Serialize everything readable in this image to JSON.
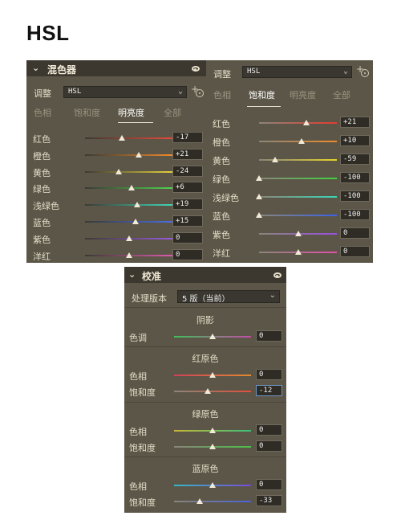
{
  "page_title": "HSL",
  "mixer": {
    "title": "混色器",
    "adjust_label": "调整",
    "adjust_value": "HSL",
    "tabs": [
      "色相",
      "饱和度",
      "明亮度",
      "全部"
    ],
    "active_tab": "明亮度",
    "rows": [
      {
        "label": "红色",
        "value": "-17",
        "level": -0.17
      },
      {
        "label": "橙色",
        "value": "+21",
        "level": 0.21
      },
      {
        "label": "黄色",
        "value": "-24",
        "level": -0.24
      },
      {
        "label": "绿色",
        "value": "+6",
        "level": 0.06
      },
      {
        "label": "浅绿色",
        "value": "+19",
        "level": 0.19
      },
      {
        "label": "蓝色",
        "value": "+15",
        "level": 0.15
      },
      {
        "label": "紫色",
        "value": "0",
        "level": 0
      },
      {
        "label": "洋红",
        "value": "0",
        "level": 0
      }
    ]
  },
  "saturation": {
    "adjust_label": "调整",
    "adjust_value": "HSL",
    "tabs": [
      "色相",
      "饱和度",
      "明亮度",
      "全部"
    ],
    "active_tab": "饱和度",
    "rows": [
      {
        "label": "红色",
        "value": "+21",
        "level": 0.21
      },
      {
        "label": "橙色",
        "value": "+10",
        "level": 0.1
      },
      {
        "label": "黄色",
        "value": "-59",
        "level": -0.59
      },
      {
        "label": "绿色",
        "value": "-100",
        "level": -1
      },
      {
        "label": "浅绿色",
        "value": "-100",
        "level": -1
      },
      {
        "label": "蓝色",
        "value": "-100",
        "level": -1
      },
      {
        "label": "紫色",
        "value": "0",
        "level": 0
      },
      {
        "label": "洋红",
        "value": "0",
        "level": 0
      }
    ]
  },
  "calibration": {
    "title": "校准",
    "process_label": "处理版本",
    "process_value": "5 版（当前）",
    "shadows": {
      "heading": "阴影",
      "rows": [
        {
          "label": "色调",
          "value": "0",
          "level": 0
        }
      ]
    },
    "red_primary": {
      "heading": "红原色",
      "rows": [
        {
          "label": "色相",
          "value": "0",
          "level": 0
        },
        {
          "label": "饱和度",
          "value": "-12",
          "level": -0.12
        }
      ]
    },
    "green_primary": {
      "heading": "绿原色",
      "rows": [
        {
          "label": "色相",
          "value": "0",
          "level": 0
        },
        {
          "label": "饱和度",
          "value": "0",
          "level": 0
        }
      ]
    },
    "blue_primary": {
      "heading": "蓝原色",
      "rows": [
        {
          "label": "色相",
          "value": "0",
          "level": 0
        },
        {
          "label": "饱和度",
          "value": "-33",
          "level": -0.33
        }
      ]
    }
  },
  "colors": {
    "panel_bg": "#5b5647",
    "header_bg": "#3c382f",
    "text": "#e3dcc8",
    "focus_border": "#6e96c8"
  }
}
